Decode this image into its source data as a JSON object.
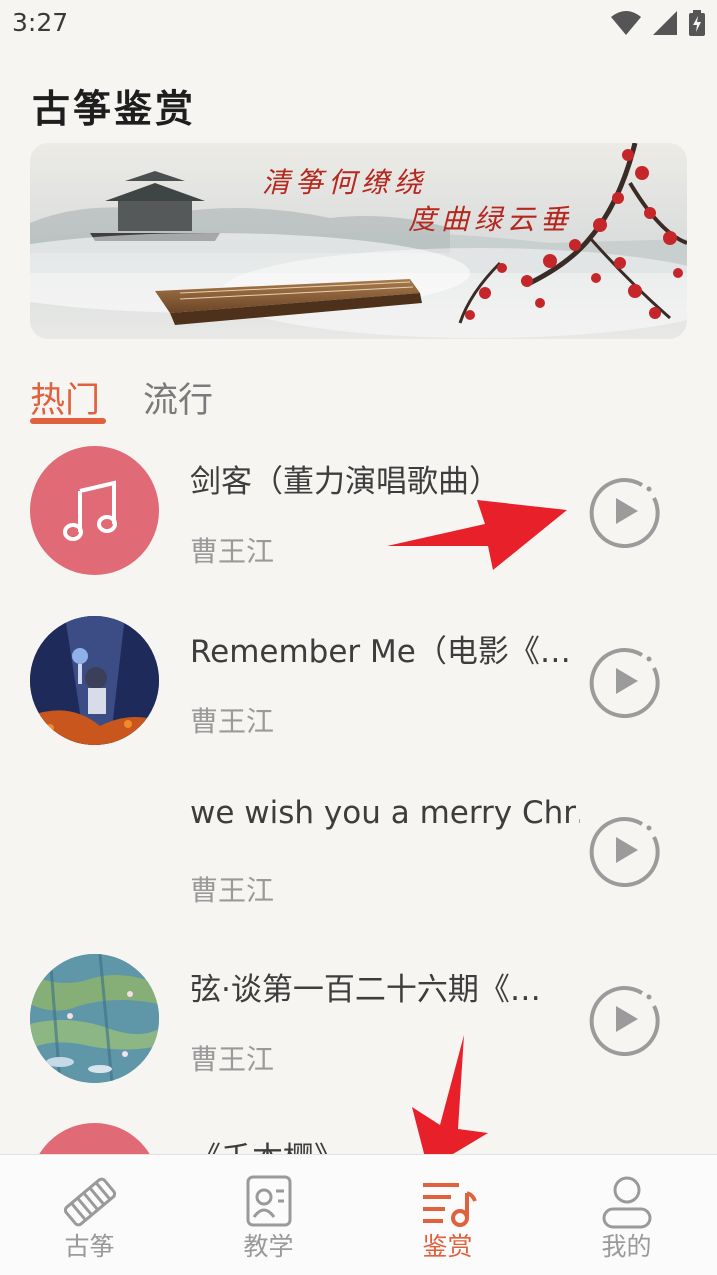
{
  "status_bar": {
    "time": "3:27"
  },
  "page": {
    "title": "古筝鉴赏"
  },
  "banner": {
    "verse_line1": "清筝何缭绕",
    "verse_line2": "度曲绿云垂"
  },
  "tabs": [
    {
      "label": "热门",
      "active": true
    },
    {
      "label": "流行",
      "active": false
    }
  ],
  "songs": [
    {
      "title": "剑客（董力演唱歌曲）",
      "artist": "曹王江",
      "cover": "music-note-cover"
    },
    {
      "title": "Remember Me（电影《…",
      "artist": "曹王江",
      "cover": "movie-poster-cover"
    },
    {
      "title": "we wish you a merry Chr…",
      "artist": "曹王江",
      "cover": "none"
    },
    {
      "title": "弦·谈第一百二十六期《…",
      "artist": "曹王江",
      "cover": "water-lilies-painting-cover"
    },
    {
      "title": "《千本樱》",
      "artist": "",
      "cover": "music-note-cover"
    }
  ],
  "bottom_nav": [
    {
      "label": "古筝",
      "icon": "guzheng-icon",
      "active": false
    },
    {
      "label": "教学",
      "icon": "teaching-icon",
      "active": false
    },
    {
      "label": "鉴赏",
      "icon": "appreciation-icon",
      "active": true
    },
    {
      "label": "我的",
      "icon": "profile-icon",
      "active": false
    }
  ],
  "colors": {
    "accent": "#e0613d",
    "cover_pink": "#e06a76",
    "arrow_red": "#e8202a"
  }
}
